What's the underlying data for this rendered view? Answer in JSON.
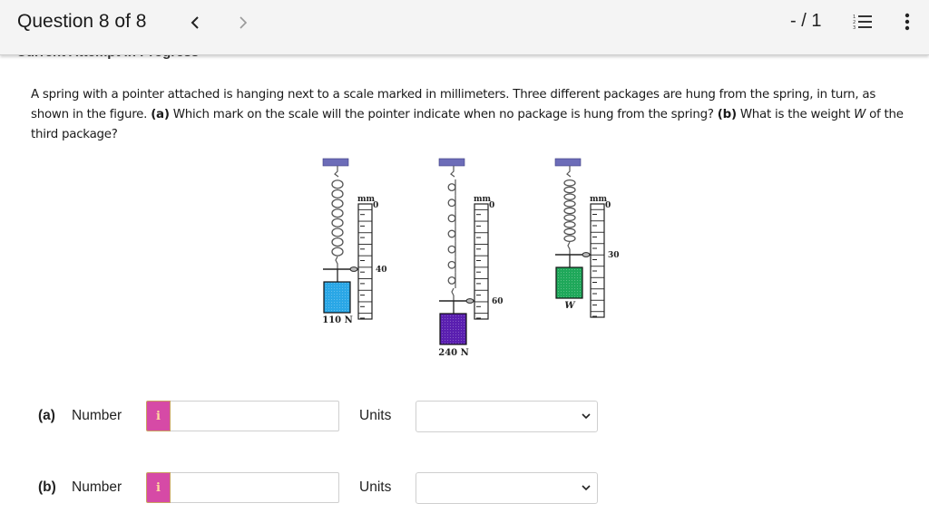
{
  "header": {
    "title": "Question 8 of 8",
    "prev_icon": "chevron-left-icon",
    "next_icon": "chevron-right-icon",
    "score": "- / 1",
    "list_icon": "numbered-list-icon",
    "more_icon": "vertical-ellipsis-icon"
  },
  "status_behind_header": "Current Attempt in Progress",
  "question": {
    "part1": "A spring with a pointer attached is hanging next to a scale marked in millimeters. Three different packages are hung from the spring, in turn, as shown in the figure. ",
    "a_tag": "(a)",
    "part2": " Which mark on the scale will the pointer indicate when no package is hung from the spring? ",
    "b_tag": "(b)",
    "part3": " What is the weight ",
    "W": "W",
    "part4": " of the third package?"
  },
  "figure": {
    "unit_label": "mm",
    "zero_label": "0",
    "setups": [
      {
        "package_label": "110 N",
        "pointer_reading_label": "40",
        "package_color": "#2aa7e6"
      },
      {
        "package_label": "240 N",
        "pointer_reading_label": "60",
        "package_color": "#5a1fb0"
      },
      {
        "package_label": "W",
        "pointer_reading_label": "30",
        "package_color": "#1fa85a"
      }
    ],
    "support_color": "#6c6cb8"
  },
  "answers": [
    {
      "part": "(a)",
      "number_label": "Number",
      "info_icon": "i",
      "number_value": "",
      "units_label": "Units",
      "units_value": ""
    },
    {
      "part": "(b)",
      "number_label": "Number",
      "info_icon": "i",
      "number_value": "",
      "units_label": "Units",
      "units_value": ""
    }
  ]
}
